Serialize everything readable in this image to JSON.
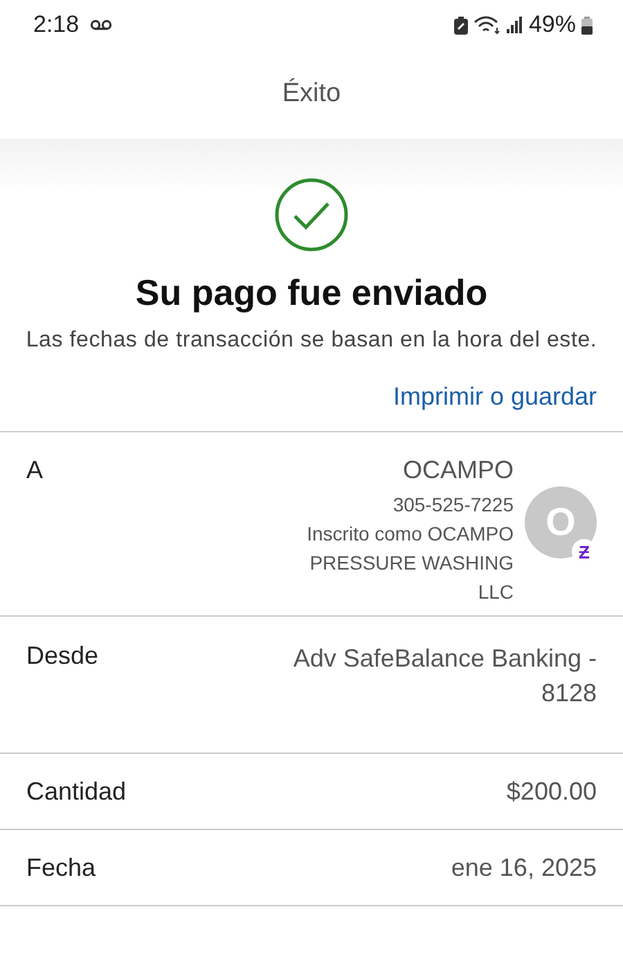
{
  "status_bar": {
    "time": "2:18",
    "battery": "49%"
  },
  "header": {
    "title": "Éxito"
  },
  "confirmation": {
    "title": "Su pago fue enviado",
    "note": "Las fechas de transacción se basan en la hora del este.",
    "link": "Imprimir o guardar"
  },
  "recipient": {
    "label": "A",
    "name": "OCAMPO",
    "phone": "305-525-7225",
    "enrolled": "Inscrito como OCAMPO PRESSURE WASHING LLC",
    "avatar": "O",
    "avatar_badge": "Ƶ"
  },
  "details": [
    {
      "label": "Desde",
      "value": "Adv SafeBalance Banking - 8128"
    },
    {
      "label": "Cantidad",
      "value": "$200.00"
    },
    {
      "label": "Fecha",
      "value": "ene 16, 2025"
    }
  ]
}
